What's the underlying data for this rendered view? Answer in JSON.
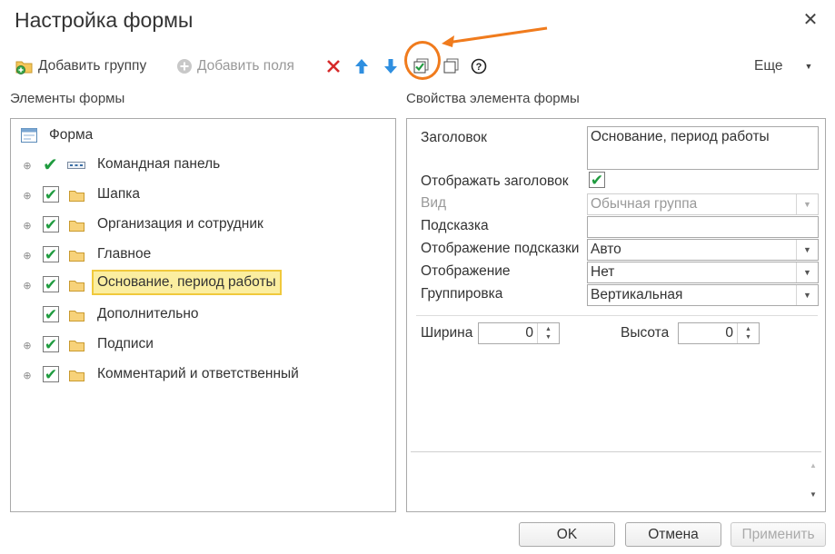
{
  "window": {
    "title": "Настройка формы"
  },
  "toolbar": {
    "add_group": "Добавить группу",
    "add_fields": "Добавить поля",
    "more": "Еще"
  },
  "sections": {
    "elements": "Элементы формы",
    "properties": "Свойства элемента формы"
  },
  "tree": {
    "root": "Форма",
    "items": [
      {
        "label": "Командная панель",
        "checked": true,
        "expandable": true
      },
      {
        "label": "Шапка",
        "checked": true,
        "expandable": true
      },
      {
        "label": "Организация и сотрудник",
        "checked": true,
        "expandable": true
      },
      {
        "label": "Главное",
        "checked": true,
        "expandable": true
      },
      {
        "label": "Основание, период работы",
        "checked": true,
        "expandable": true,
        "selected": true
      },
      {
        "label": "Дополнительно",
        "checked": true,
        "expandable": false
      },
      {
        "label": "Подписи",
        "checked": true,
        "expandable": true
      },
      {
        "label": "Комментарий и ответственный",
        "checked": true,
        "expandable": true
      }
    ]
  },
  "properties": {
    "title_label": "Заголовок",
    "title_value": "Основание, период работы",
    "show_title_label": "Отображать заголовок",
    "show_title_checked": true,
    "view_label": "Вид",
    "view_value": "Обычная группа",
    "hint_label": "Подсказка",
    "hint_value": "",
    "hint_display_label": "Отображение подсказки",
    "hint_display_value": "Авто",
    "display_label": "Отображение",
    "display_value": "Нет",
    "grouping_label": "Группировка",
    "grouping_value": "Вертикальная",
    "width_label": "Ширина",
    "width_value": "0",
    "height_label": "Высота",
    "height_value": "0"
  },
  "buttons": {
    "ok": "OK",
    "cancel": "Отмена",
    "apply": "Применить"
  },
  "colors": {
    "accent_check": "#1f9b3f",
    "annotation": "#f07b1d",
    "selection_fill": "#fbeea0",
    "selection_border": "#f0c93c"
  }
}
